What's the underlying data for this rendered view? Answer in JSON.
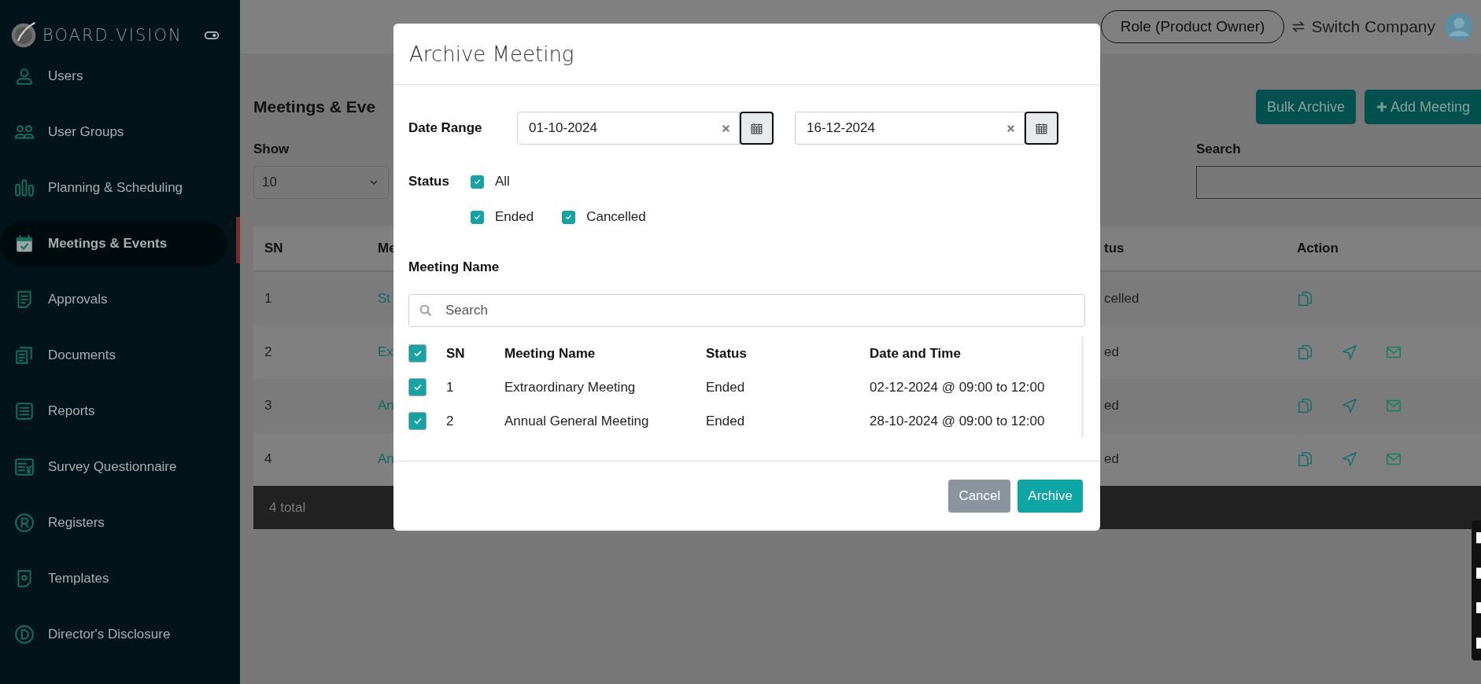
{
  "sidebar": {
    "logo": "BOARD.VISION",
    "items": [
      {
        "label": "Users",
        "selected": false
      },
      {
        "label": "User Groups",
        "selected": false
      },
      {
        "label": "Planning & Scheduling",
        "selected": false
      },
      {
        "label": "Meetings & Events",
        "selected": true
      },
      {
        "label": "Approvals",
        "selected": false
      },
      {
        "label": "Documents",
        "selected": false
      },
      {
        "label": "Reports",
        "selected": false
      },
      {
        "label": "Survey Questionnaire",
        "selected": false
      },
      {
        "label": "Registers",
        "selected": false
      },
      {
        "label": "Templates",
        "selected": false
      },
      {
        "label": "Director's Disclosure",
        "selected": false
      }
    ]
  },
  "header": {
    "role_button": "Role (Product Owner)",
    "switch_company": "Switch Company"
  },
  "page": {
    "title": "Meetings & Eve",
    "buttons": [
      "Bulk Archive",
      "Add Meeting"
    ],
    "show_label": "Show",
    "show_value": "10",
    "search_label": "Search"
  },
  "table": {
    "columns": [
      "SN",
      "Me",
      "tus",
      "Action"
    ],
    "rows": [
      {
        "sn": "1",
        "name": "St",
        "status": "celled",
        "actions": [
          {
            "kind": "copy"
          }
        ]
      },
      {
        "sn": "2",
        "name": "Ex",
        "status": "ed",
        "actions": [
          {
            "kind": "copy"
          },
          {
            "kind": "send"
          },
          {
            "kind": "mail"
          }
        ]
      },
      {
        "sn": "3",
        "name": "An",
        "status": "ed",
        "actions": [
          {
            "kind": "copy"
          },
          {
            "kind": "send"
          },
          {
            "kind": "mail"
          }
        ]
      },
      {
        "sn": "4",
        "name": "An",
        "status": "ed",
        "actions": [
          {
            "kind": "copy"
          },
          {
            "kind": "send"
          },
          {
            "kind": "mail"
          }
        ]
      }
    ],
    "footer": "4 total"
  },
  "modal": {
    "title": "Archive Meeting",
    "date_label": "Date Range",
    "dates": [
      {
        "value": "01-10-2024"
      },
      {
        "value": "16-12-2024"
      }
    ],
    "status_label": "Status",
    "statuses": [
      {
        "label": "All",
        "checked": true
      },
      {
        "label": "Ended",
        "checked": true
      },
      {
        "label": "Cancelled",
        "checked": true
      }
    ],
    "meeting_label": "Meeting Name",
    "search": {
      "placeholder": "Search"
    },
    "table": {
      "all_checked": true,
      "columns": [
        "SN",
        "Meeting Name",
        "Status",
        "Date and Time"
      ],
      "rows": [
        {
          "checked": true,
          "sn": "1",
          "name": "Extraordinary Meeting",
          "status": "Ended",
          "date": "02-12-2024 @ 09:00 to 12:00"
        },
        {
          "checked": true,
          "sn": "2",
          "name": "Annual General Meeting",
          "status": "Ended",
          "date": "28-10-2024 @ 09:00 to 12:00"
        }
      ]
    },
    "buttons": [
      {
        "label": "Cancel",
        "kind": "secondary"
      },
      {
        "label": "Archive",
        "kind": "primary"
      }
    ]
  }
}
